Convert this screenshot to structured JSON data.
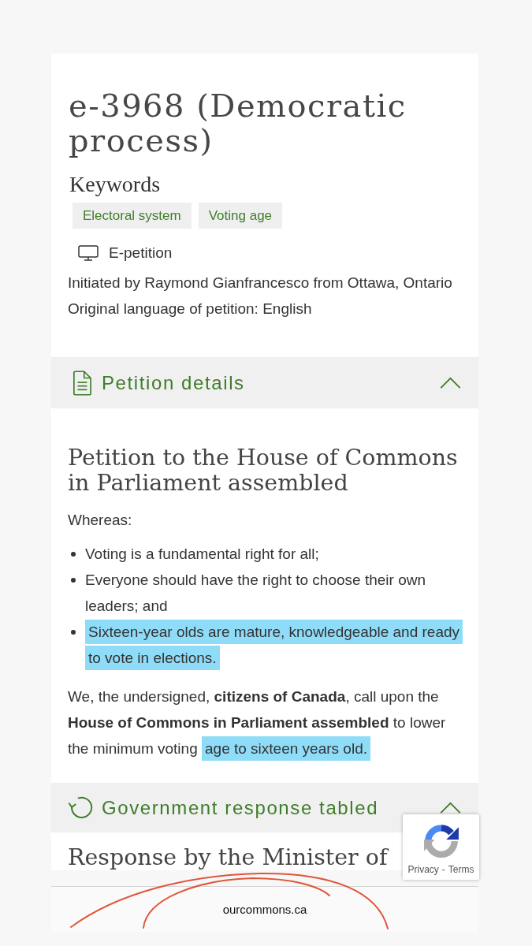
{
  "petition": {
    "title": "e-3968 (Democratic process)",
    "keywords_heading": "Keywords",
    "keywords": [
      "Electoral system",
      "Voting age"
    ],
    "type": {
      "kind": "electronic",
      "label": "E-petition"
    },
    "initiated_by": "Initiated by Raymond Gianfrancesco from Ottawa, Ontario",
    "original_language": "Original language of petition: English"
  },
  "sections": [
    {
      "kind": "details",
      "title": "Petition details",
      "expanded": true,
      "heading": "Petition to the House of Commons in Parliament assembled",
      "intro": "Whereas:",
      "points": [
        {
          "text": "Voting is a fundamental right for all;",
          "highlighted": false
        },
        {
          "text": "Everyone should have the right to choose their own leaders; and",
          "highlighted": false
        },
        {
          "text": "Sixteen-year olds are mature, knowledgeable and ready to vote in elections.",
          "highlighted": true
        }
      ],
      "prayer": [
        {
          "text": "We, the undersigned, **citizens of Canada**, call upon the **House of Commons in Parliament assembled** to lower the minimum voting ",
          "highlighted": false
        },
        {
          "text": "age to sixteen years old.",
          "highlighted": true
        }
      ]
    },
    {
      "kind": "response",
      "title": "Government response tabled",
      "expanded": true,
      "heading": "Response by the Minister of"
    }
  ],
  "recaptcha": {
    "links": [
      "Privacy",
      "Terms"
    ],
    "separator": "-"
  },
  "browser_bar": {
    "url": "ourcommons.ca"
  }
}
